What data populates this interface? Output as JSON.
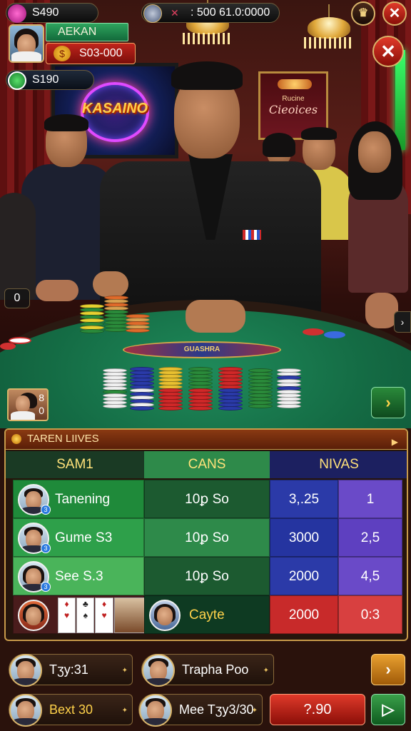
{
  "hud": {
    "top_coins": "S490",
    "jackpot": ": 500 61.0:0000",
    "player_name": "AEKAN",
    "player_balance": "S03-000",
    "coins_2": "S190",
    "seat_count": "0",
    "side_count": "8\n0"
  },
  "venue": {
    "tv_logo": "KASAINO",
    "sign_small": "Rucine",
    "sign_big": "Cieoices"
  },
  "table": {
    "emblem": "GUASHRA"
  },
  "leaderboard": {
    "title": "TAREN LIIVES",
    "columns": [
      "SAM1",
      "CANS",
      "NIVAS"
    ],
    "rows": [
      {
        "name": "Tanening",
        "cans": "10ꝑ So",
        "nivas": "3,.25",
        "extra": "1",
        "badge": "3"
      },
      {
        "name": "Gume S3",
        "cans": "10ꝑ So",
        "nivas": "3000",
        "extra": "2,5",
        "badge": "3"
      },
      {
        "name": "See S.3",
        "cans": "10ꝑ So",
        "nivas": "2000",
        "extra": "4,5",
        "badge": "3"
      },
      {
        "name": "",
        "cans": "Cayte",
        "nivas": "2000",
        "extra": "0:3",
        "badge": ""
      }
    ]
  },
  "bottom": {
    "slots": [
      "Tʒy:31",
      "Trapha Poo",
      "Bext 30",
      "Mee Tʒy3/30"
    ],
    "bet_value": "?.90"
  },
  "icons": {
    "coin": "coin-icon",
    "settings": "gear-icon",
    "crown": "crown-icon",
    "close": "close-icon",
    "next": "chevron-right-icon",
    "play": "play-icon"
  },
  "colors": {
    "felt": "#146b44",
    "gold_border": "#c79a4a",
    "green_cell": "#1f8a3a",
    "blue_cell": "#2b3aa8",
    "red_cell": "#c82a2a"
  }
}
